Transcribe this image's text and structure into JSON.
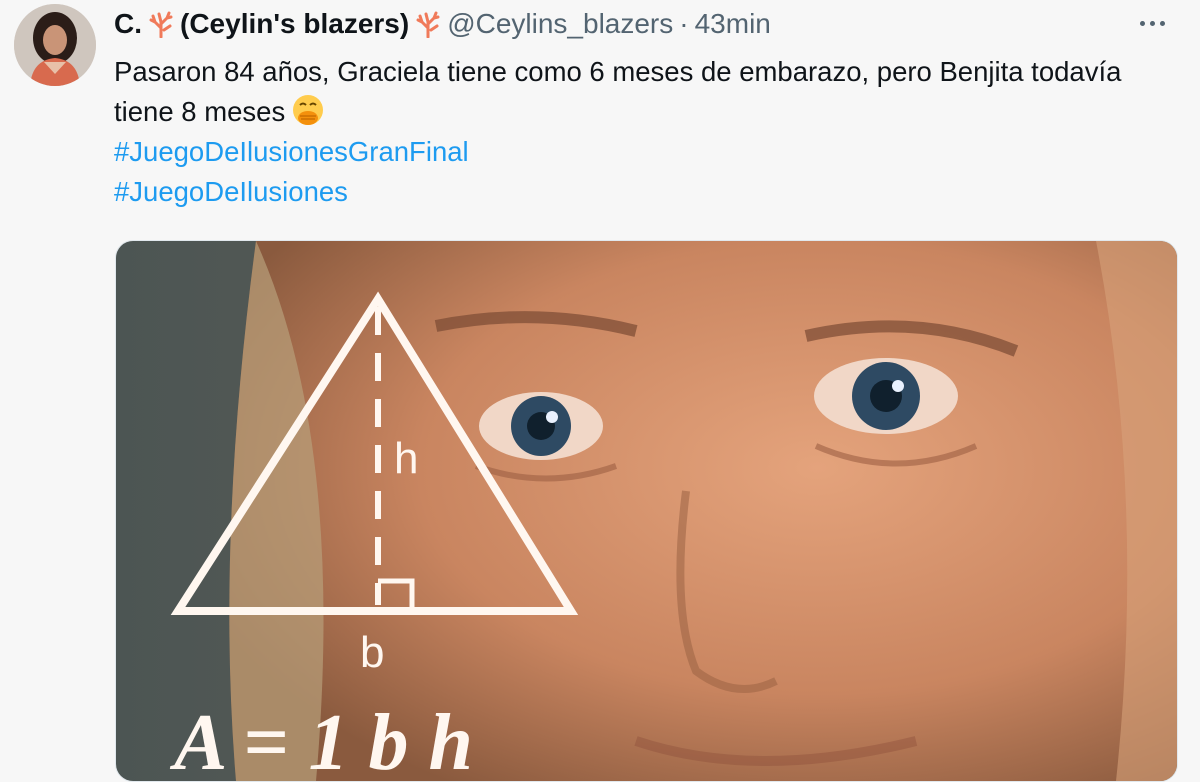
{
  "tweet": {
    "display_name_prefix": "C.",
    "display_name": "(Ceylin's blazers)",
    "handle": "@Ceylins_blazers",
    "separator": "·",
    "time": "43min",
    "text": "Pasaron 84 años, Graciela tiene como 6 meses de embarazo, pero Benjita todavía tiene 8 meses",
    "emoji": "face-with-hand-over-mouth",
    "hashtags": [
      "#JuegoDeIlusionesGranFinal",
      "#JuegoDeIlusiones"
    ]
  },
  "media": {
    "description_icon": "math-lady-meme",
    "labels": {
      "height": "h",
      "base": "b",
      "formula": "A = 1 b h"
    }
  },
  "colors": {
    "link": "#1d9bf0",
    "muted": "#536471",
    "background": "#f7f7f7"
  }
}
